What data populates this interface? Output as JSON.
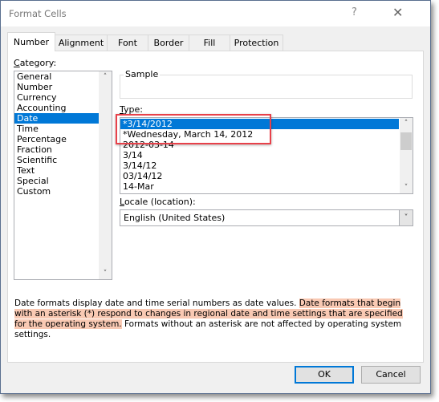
{
  "window": {
    "title": "Format Cells",
    "help_icon": "?",
    "close_icon": "✕"
  },
  "tabs": [
    "Number",
    "Alignment",
    "Font",
    "Border",
    "Fill",
    "Protection"
  ],
  "category": {
    "label_accel": "C",
    "label_rest": "ategory:",
    "items": [
      "General",
      "Number",
      "Currency",
      "Accounting",
      "Date",
      "Time",
      "Percentage",
      "Fraction",
      "Scientific",
      "Text",
      "Special",
      "Custom"
    ],
    "selected": "Date"
  },
  "sample": {
    "label": "Sample"
  },
  "type": {
    "label_accel": "T",
    "label_rest": "ype:",
    "items": [
      "*3/14/2012",
      "*Wednesday, March 14, 2012",
      "2012-03-14",
      "3/14",
      "3/14/12",
      "03/14/12",
      "14-Mar"
    ],
    "selected": "*3/14/2012"
  },
  "locale": {
    "label_accel": "L",
    "label_rest": "ocale (location):",
    "value": "English (United States)"
  },
  "description": {
    "part1": "Date formats display date and time serial numbers as date values. ",
    "highlight": "Date formats that begin with an asterisk (*) respond to changes in regional date and time settings that are specified for the operating system.",
    "part2": " Formats without an asterisk are not affected by operating system settings."
  },
  "buttons": {
    "ok": "OK",
    "cancel": "Cancel"
  },
  "colors": {
    "selection": "#0078d7",
    "highlight": "#f9c9b3",
    "annotation_box": "#e8414a"
  }
}
